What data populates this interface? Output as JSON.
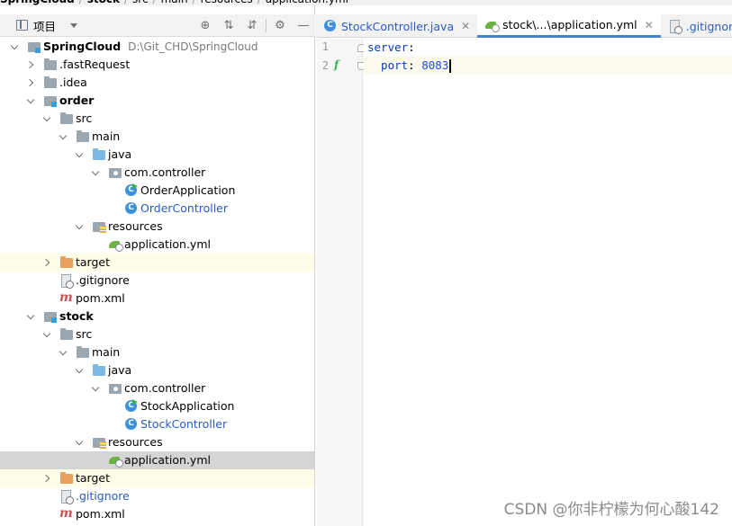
{
  "breadcrumb": [
    "SpringCloud",
    "stock",
    "src",
    "main",
    "resources",
    "application.yml"
  ],
  "project_panel": {
    "title": "项目",
    "tools": [
      "crosshair-icon",
      "expand-all-icon",
      "collapse-all-icon",
      "gear-icon",
      "minimize-icon"
    ]
  },
  "tree": [
    {
      "label": "SpringCloud",
      "path": "D:\\Git_CHD\\SpringCloud",
      "icon": "folder-module",
      "indent": 0,
      "arrow": "down",
      "bold": true
    },
    {
      "label": ".fastRequest",
      "icon": "folder-gray",
      "indent": 1,
      "arrow": "right"
    },
    {
      "label": ".idea",
      "icon": "folder-gray",
      "indent": 1,
      "arrow": "right"
    },
    {
      "label": "order",
      "icon": "folder-module",
      "indent": 1,
      "arrow": "down",
      "bold": true
    },
    {
      "label": "src",
      "icon": "folder-gray",
      "indent": 2,
      "arrow": "down"
    },
    {
      "label": "main",
      "icon": "folder-gray",
      "indent": 3,
      "arrow": "down"
    },
    {
      "label": "java",
      "icon": "folder-blue",
      "indent": 4,
      "arrow": "down"
    },
    {
      "label": "com.controller",
      "icon": "folder-pkg",
      "indent": 5,
      "arrow": "down"
    },
    {
      "label": "OrderApplication",
      "icon": "cls-run",
      "indent": 6,
      "arrow": "none"
    },
    {
      "label": "OrderController",
      "icon": "cls",
      "indent": 6,
      "arrow": "none",
      "blue": true
    },
    {
      "label": "resources",
      "icon": "folder-res",
      "indent": 4,
      "arrow": "down"
    },
    {
      "label": "application.yml",
      "icon": "yml",
      "indent": 5,
      "arrow": "none"
    },
    {
      "label": "target",
      "icon": "folder-orange",
      "indent": 2,
      "arrow": "right",
      "hl": "yellow"
    },
    {
      "label": ".gitignore",
      "icon": "git",
      "indent": 2,
      "arrow": "none"
    },
    {
      "label": "pom.xml",
      "icon": "maven",
      "indent": 2,
      "arrow": "none"
    },
    {
      "label": "stock",
      "icon": "folder-module",
      "indent": 1,
      "arrow": "down",
      "bold": true
    },
    {
      "label": "src",
      "icon": "folder-gray",
      "indent": 2,
      "arrow": "down"
    },
    {
      "label": "main",
      "icon": "folder-gray",
      "indent": 3,
      "arrow": "down"
    },
    {
      "label": "java",
      "icon": "folder-blue",
      "indent": 4,
      "arrow": "down"
    },
    {
      "label": "com.controller",
      "icon": "folder-pkg",
      "indent": 5,
      "arrow": "down"
    },
    {
      "label": "StockApplication",
      "icon": "cls-run",
      "indent": 6,
      "arrow": "none"
    },
    {
      "label": "StockController",
      "icon": "cls",
      "indent": 6,
      "arrow": "none",
      "blue": true
    },
    {
      "label": "resources",
      "icon": "folder-res",
      "indent": 4,
      "arrow": "down"
    },
    {
      "label": "application.yml",
      "icon": "yml",
      "indent": 5,
      "arrow": "none",
      "hl": "selected"
    },
    {
      "label": "target",
      "icon": "folder-orange",
      "indent": 2,
      "arrow": "right",
      "hl": "yellow"
    },
    {
      "label": ".gitignore",
      "icon": "git",
      "indent": 2,
      "arrow": "none",
      "blue": true
    },
    {
      "label": "pom.xml",
      "icon": "maven",
      "indent": 2,
      "arrow": "none"
    }
  ],
  "tabs": [
    {
      "label": "StockController.java",
      "icon": "cls",
      "blue": true,
      "active": false
    },
    {
      "label": "stock\\...\\application.yml",
      "icon": "yml",
      "blue": false,
      "active": true
    },
    {
      "label": ".gitignore",
      "icon": "git",
      "blue": true,
      "active": false
    }
  ],
  "editor": {
    "lines": [
      {
        "number": "1",
        "key": "server",
        "sep": ":",
        "value": ""
      },
      {
        "number": "2",
        "key": "  port",
        "sep": ": ",
        "value": "8083"
      }
    ],
    "gutter_marker": "f",
    "colors": {
      "key": "#0a3ab1",
      "number": "#1750eb",
      "accent": "#4083c9"
    }
  },
  "watermark": "CSDN @你非柠檬为何心酸142"
}
